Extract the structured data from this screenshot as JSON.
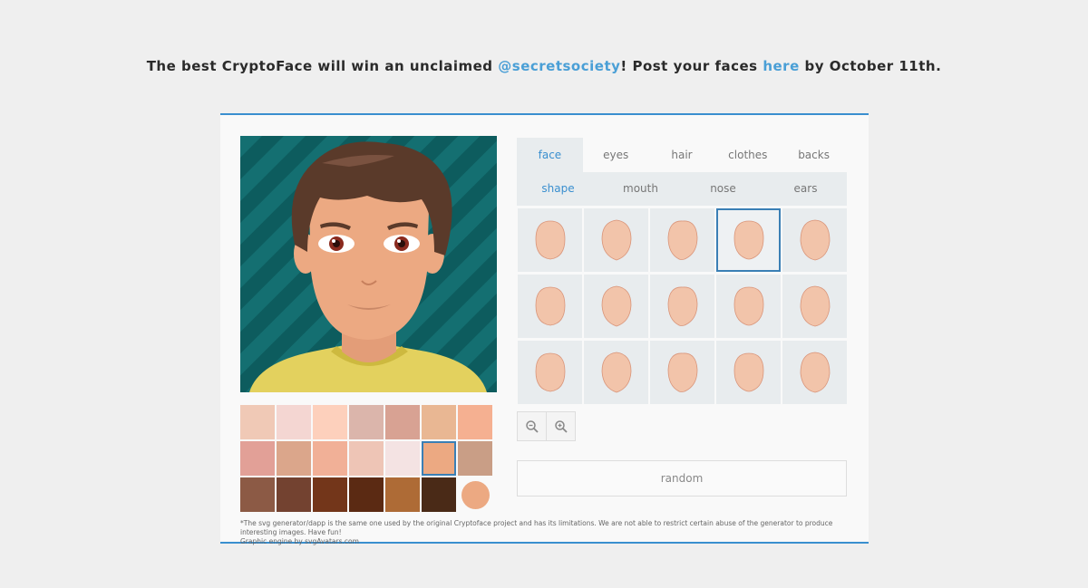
{
  "headline": {
    "part1": "The best CryptoFace will win an unclaimed ",
    "link1": "@secretsociety",
    "part2": "! Post your faces ",
    "link2": "here",
    "part3": " by October 11th."
  },
  "tabs": [
    {
      "label": "face",
      "active": true
    },
    {
      "label": "eyes"
    },
    {
      "label": "hair"
    },
    {
      "label": "clothes"
    },
    {
      "label": "backs"
    }
  ],
  "subtabs": [
    {
      "label": "shape",
      "active": true
    },
    {
      "label": "mouth"
    },
    {
      "label": "nose"
    },
    {
      "label": "ears"
    }
  ],
  "face_shapes": {
    "count": 15,
    "selected_index": 3
  },
  "skin_palette": {
    "colors": [
      "#f0c9b6",
      "#f4d6d2",
      "#fdd0bc",
      "#dbb5ab",
      "#d8a293",
      "#e9b793",
      "#f5b091",
      "#e2a097",
      "#dba68b",
      "#f1b097",
      "#eec5b6",
      "#f4e3e3",
      "#eca982",
      "#c99e86",
      "#8c5a45",
      "#734230",
      "#73361a",
      "#5b2a13",
      "#ae6b36",
      "#4a2a17"
    ],
    "selected_index": 12,
    "current": "#eca982"
  },
  "zoom": {
    "out_icon": "zoom-out-icon",
    "in_icon": "zoom-in-icon"
  },
  "random_label": "random",
  "footnote": {
    "line1": "*The svg generator/dapp is the same one used by the original Cryptoface project and has its limitations. We are not able to restrict certain abuse of the generator to produce interesting images. Have fun!",
    "line2": "Graphic engine by svgAvatars.com"
  },
  "colors": {
    "accent": "#3a8fcf",
    "link": "#4a9fd6",
    "background": "#efefef",
    "avatar_bg": "#0e5f61",
    "skin": "#eca982",
    "hair": "#5a3a2a",
    "shirt": "#e3d15e"
  }
}
